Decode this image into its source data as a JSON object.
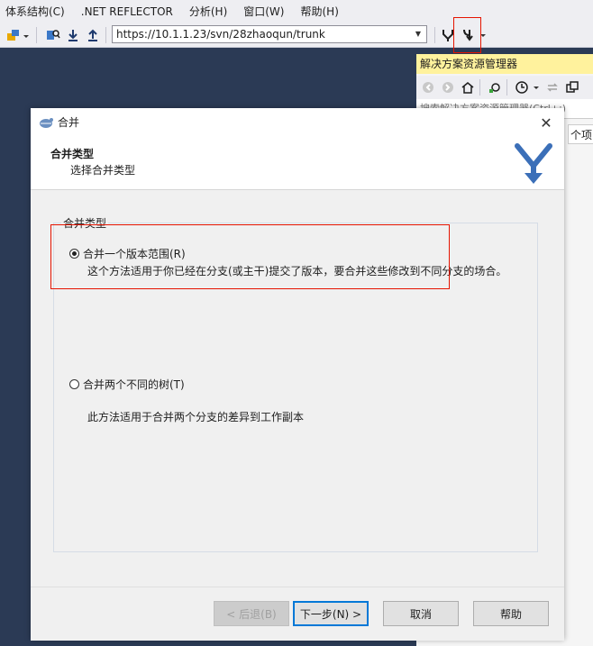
{
  "menubar": {
    "items": [
      "体系结构(C)",
      ".NET REFLECTOR",
      "分析(H)",
      "窗口(W)",
      "帮助(H)"
    ]
  },
  "toolbar": {
    "url": "https://10.1.1.23/svn/28zhaoqun/trunk"
  },
  "solution_explorer": {
    "title": "解决方案资源管理器",
    "search_text": "搜索解决方案资源管理器(Ctrl+;)",
    "column_fragment": "个项目"
  },
  "dialog": {
    "title": "合并",
    "header_title": "合并类型",
    "header_subtitle": "选择合并类型",
    "group_label": "合并类型",
    "option1_label": "合并一个版本范围(R)",
    "option1_desc": "这个方法适用于你已经在分支(或主干)提交了版本，要合并这些修改到不同分支的场合。",
    "option2_label": "合并两个不同的树(T)",
    "option2_desc": "此方法适用于合并两个分支的差异到工作副本",
    "back_label": "< 后退(B)",
    "next_label": "下一步(N) >",
    "cancel_label": "取消",
    "help_label": "帮助"
  },
  "colors": {
    "highlight": "#e51400",
    "ide_background": "#2b3a55",
    "solution_title_bg": "#fff29d"
  }
}
